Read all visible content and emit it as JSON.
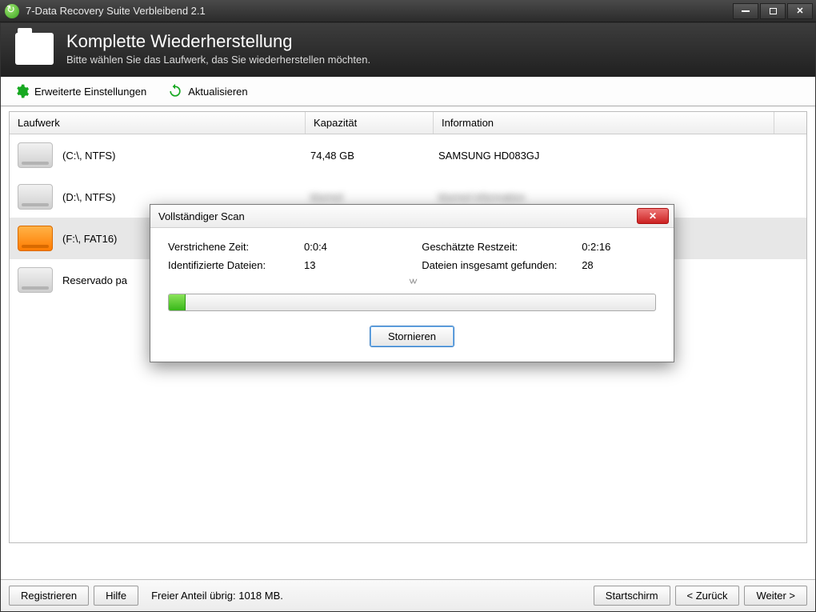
{
  "titlebar": {
    "title": "7-Data Recovery Suite Verbleibend 2.1"
  },
  "header": {
    "title": "Komplette Wiederherstellung",
    "subtitle": "Bitte wählen Sie das Laufwerk, das Sie wiederherstellen möchten."
  },
  "toolbar": {
    "advanced": "Erweiterte Einstellungen",
    "refresh": "Aktualisieren"
  },
  "columns": {
    "drive": "Laufwerk",
    "capacity": "Kapazität",
    "info": "Information"
  },
  "drives": [
    {
      "name": "(C:\\, NTFS)",
      "capacity": "74,48 GB",
      "info": "SAMSUNG HD083GJ",
      "icon": "gray",
      "selected": false
    },
    {
      "name": "(D:\\, NTFS)",
      "capacity": "",
      "info": "",
      "icon": "gray",
      "selected": false
    },
    {
      "name": "(F:\\, FAT16)",
      "capacity": "",
      "info": "",
      "icon": "orange",
      "selected": true
    },
    {
      "name": "Reservado pa",
      "capacity": "",
      "info": "",
      "icon": "gray",
      "selected": false
    }
  ],
  "dialog": {
    "title": "Vollständiger Scan",
    "elapsed_label": "Verstrichene Zeit:",
    "elapsed_value": "0:0:4",
    "remaining_label": "Geschätzte Restzeit:",
    "remaining_value": "0:2:16",
    "identified_label": "Identifizierte Dateien:",
    "identified_value": "13",
    "total_found_label": "Dateien insgesamt gefunden:",
    "total_found_value": "28",
    "progress_percent": 3.5,
    "cancel": "Stornieren"
  },
  "footer": {
    "register": "Registrieren",
    "help": "Hilfe",
    "free_space": "Freier Anteil übrig: 1018 MB.",
    "home": "Startschirm",
    "back": "< Zurück",
    "next": "Weiter >"
  }
}
